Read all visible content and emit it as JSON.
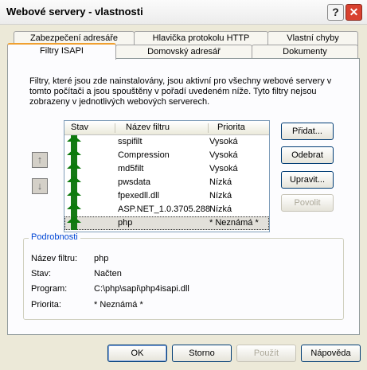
{
  "window": {
    "title": "Webové servery - vlastnosti",
    "help_glyph": "?",
    "close_glyph": "✕"
  },
  "tabs": {
    "row1": [
      "Zabezpečení adresáře",
      "Hlavička protokolu HTTP",
      "Vlastní chyby"
    ],
    "row2": [
      "Filtry ISAPI",
      "Domovský adresář",
      "Dokumenty"
    ],
    "active": "Filtry ISAPI"
  },
  "description": "Filtry, které jsou zde nainstalovány, jsou aktivní pro všechny webové servery v tomto počítači a jsou spouštěny v pořadí uvedeném níže. Tyto filtry nejsou zobrazeny v jednotlivých webových serverech.",
  "move_up_glyph": "↑",
  "move_down_glyph": "↓",
  "filter_list": {
    "headers": [
      "Stav",
      "Název filtru",
      "Priorita"
    ],
    "status_icon": "green-up-arrow-icon",
    "rows": [
      {
        "name": "sspifilt",
        "priority": "Vysoká"
      },
      {
        "name": "Compression",
        "priority": "Vysoká"
      },
      {
        "name": "md5filt",
        "priority": "Vysoká"
      },
      {
        "name": "pwsdata",
        "priority": "Nízká"
      },
      {
        "name": "fpexedll.dll",
        "priority": "Nízká"
      },
      {
        "name": "ASP.NET_1.0.3705.288",
        "priority": "Nízká"
      },
      {
        "name": "php",
        "priority": "* Neznámá *"
      }
    ],
    "selected": "php"
  },
  "buttons": {
    "add": "Přidat...",
    "remove": "Odebrat",
    "edit": "Upravit...",
    "enable": "Povolit"
  },
  "details": {
    "title": "Podrobnosti",
    "name_label": "Název filtru:",
    "name_value": "php",
    "status_label": "Stav:",
    "status_value": "Načten",
    "program_label": "Program:",
    "program_value": "C:\\php\\sapi\\php4isapi.dll",
    "priority_label": "Priorita:",
    "priority_value": "* Neznámá *"
  },
  "footer": {
    "ok": "OK",
    "cancel": "Storno",
    "apply": "Použít",
    "help": "Nápověda"
  }
}
